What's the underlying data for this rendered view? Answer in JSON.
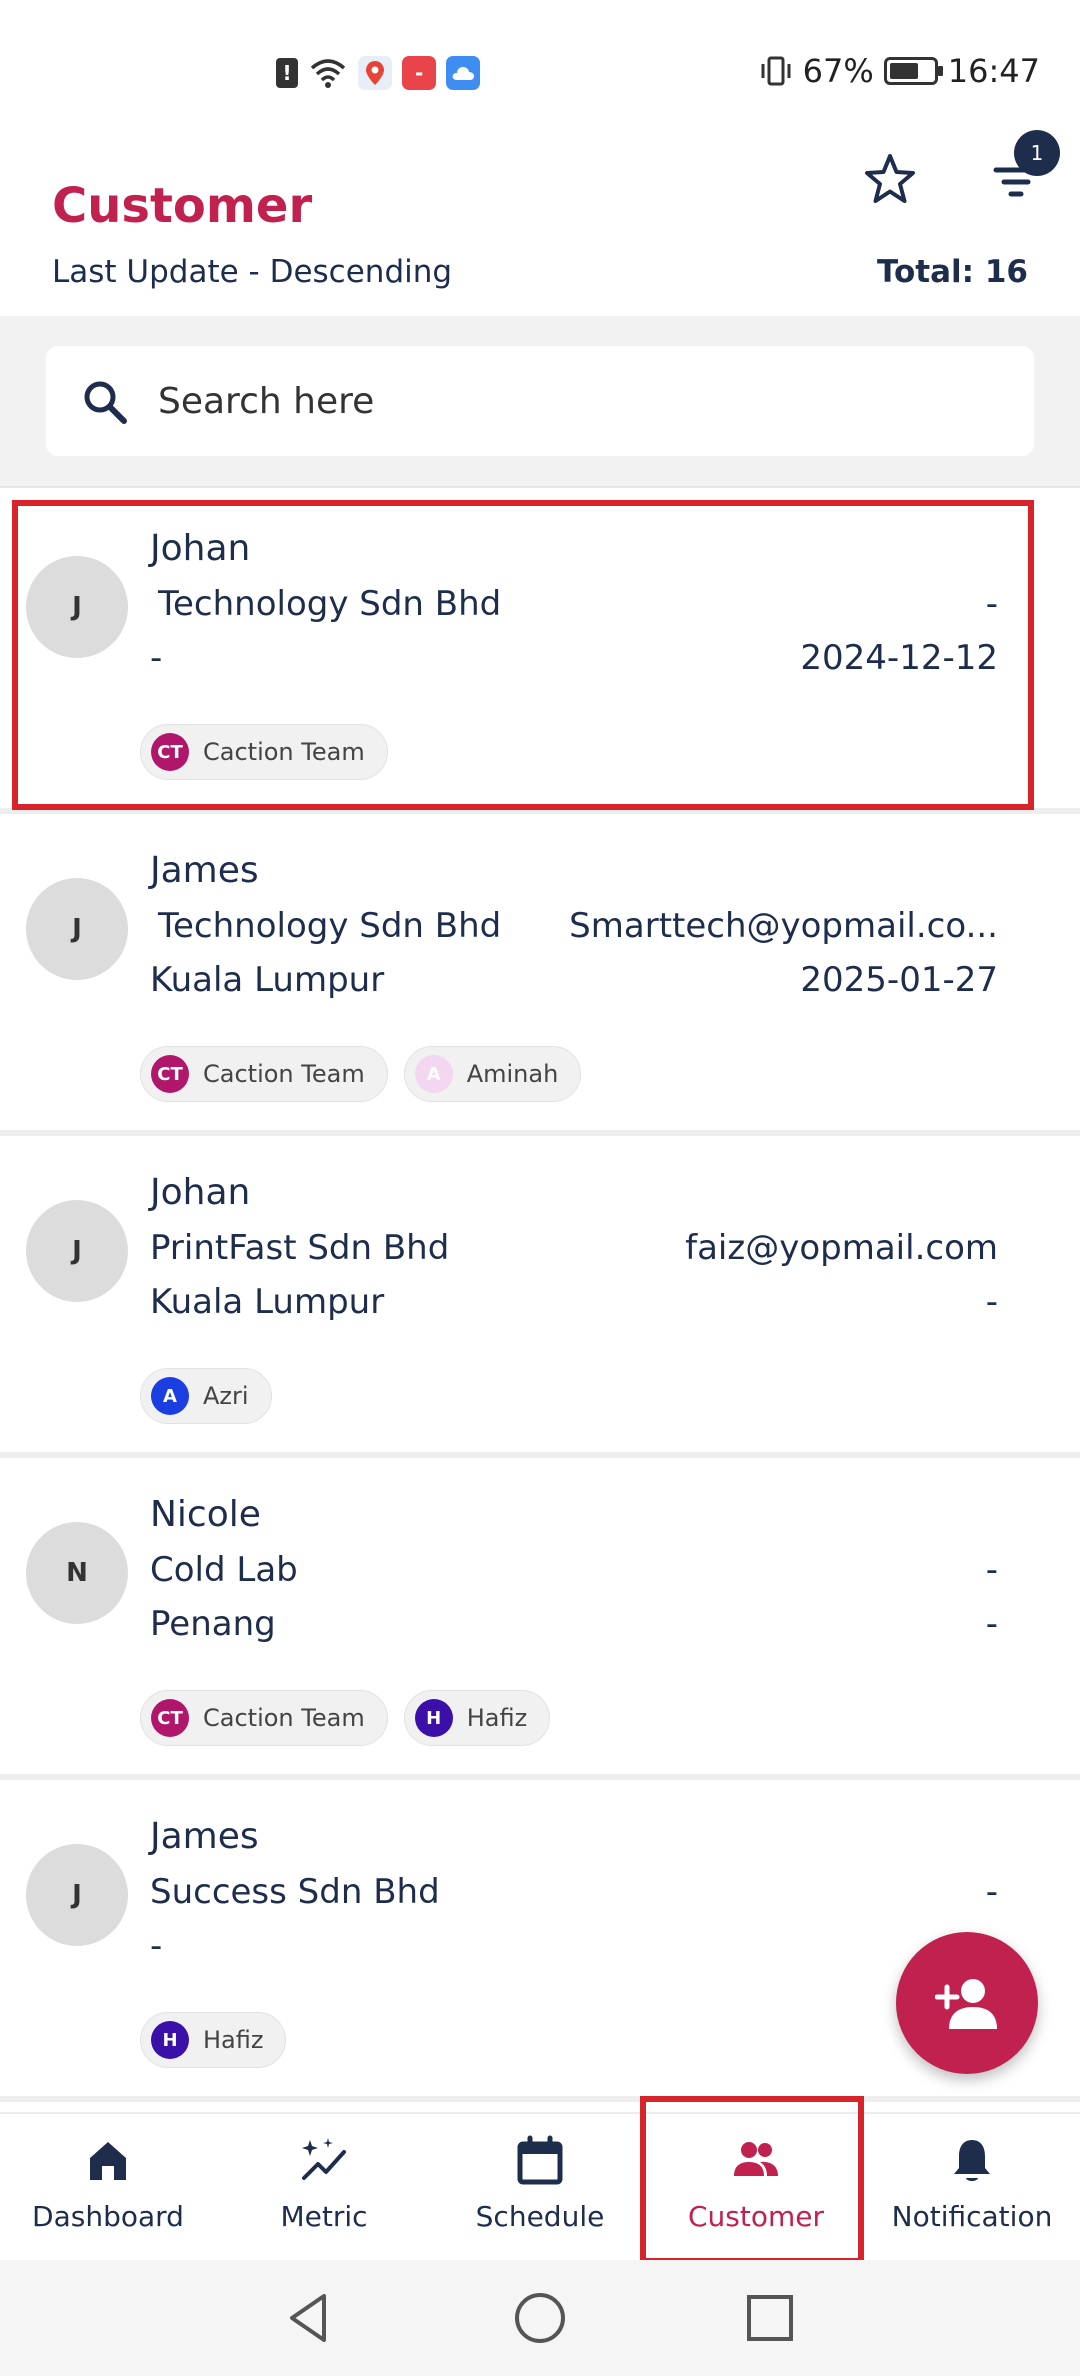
{
  "status_bar": {
    "battery_percent": "67%",
    "battery_level": 0.67,
    "time": "16:47",
    "icons": [
      "alert-icon",
      "wifi-icon",
      "maps-app-icon",
      "huawei-app-icon",
      "cloud-app-icon"
    ]
  },
  "header": {
    "title": "Customer",
    "sort_label": "Last Update - Descending",
    "total_label": "Total: 16",
    "filter_badge": "1"
  },
  "search": {
    "placeholder": "Search here"
  },
  "customers": [
    {
      "avatar": "J",
      "name": "Johan",
      "company": "Technology Sdn Bhd",
      "email": "-",
      "location": "-",
      "date": "2024-12-12",
      "tags": [
        {
          "initials": "CT",
          "label": "Caction Team",
          "color": "#b0176b"
        }
      ]
    },
    {
      "avatar": "J",
      "name": "James",
      "company": "Technology Sdn Bhd",
      "email": "Smarttech@yopmail.co...",
      "location": "Kuala Lumpur",
      "date": "2025-01-27",
      "tags": [
        {
          "initials": "CT",
          "label": "Caction Team",
          "color": "#b0176b"
        },
        {
          "initials": "A",
          "label": "Aminah",
          "color": "#f3d6f0"
        }
      ]
    },
    {
      "avatar": "J",
      "name": "Johan",
      "company": "PrintFast Sdn Bhd",
      "email": "faiz@yopmail.com",
      "location": "Kuala Lumpur",
      "date": "-",
      "tags": [
        {
          "initials": "A",
          "label": "Azri",
          "color": "#1a3ee0"
        }
      ]
    },
    {
      "avatar": "N",
      "name": "Nicole",
      "company": "Cold Lab",
      "email": "-",
      "location": "Penang",
      "date": "-",
      "tags": [
        {
          "initials": "CT",
          "label": "Caction Team",
          "color": "#b0176b"
        },
        {
          "initials": "H",
          "label": "Hafiz",
          "color": "#3b10a8"
        }
      ]
    },
    {
      "avatar": "J",
      "name": "James",
      "company": "Success Sdn Bhd",
      "email": "-",
      "location": "-",
      "date": "",
      "tags": [
        {
          "initials": "H",
          "label": "Hafiz",
          "color": "#3b10a8"
        }
      ]
    }
  ],
  "bottom_nav": [
    {
      "label": "Dashboard",
      "icon": "home-icon"
    },
    {
      "label": "Metric",
      "icon": "sparkle-chart-icon"
    },
    {
      "label": "Schedule",
      "icon": "calendar-icon"
    },
    {
      "label": "Customer",
      "icon": "people-icon",
      "active": true
    },
    {
      "label": "Notification",
      "icon": "bell-icon"
    }
  ],
  "colors": {
    "brand": "#c0214f",
    "text": "#1f2d4d",
    "highlight": "#d8232a"
  }
}
